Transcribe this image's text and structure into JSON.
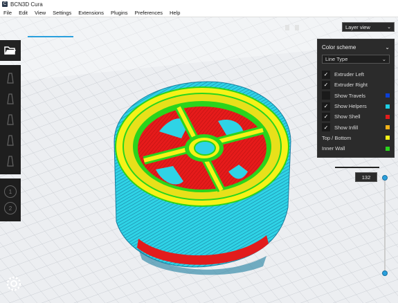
{
  "window": {
    "title": "BCN3D Cura",
    "app_icon_letter": "C"
  },
  "menu": [
    "File",
    "Edit",
    "View",
    "Settings",
    "Extensions",
    "Plugins",
    "Preferences",
    "Help"
  ],
  "view_selector": {
    "value": "Layer view"
  },
  "panel": {
    "title": "Color scheme",
    "dropdown_value": "Line Type",
    "checked_items": [
      {
        "label": "Extruder Left",
        "checked": true
      },
      {
        "label": "Extruder Right",
        "checked": true
      },
      {
        "label": "Show Travels",
        "checked": false,
        "color": "#0b3fd6"
      },
      {
        "label": "Show Helpers",
        "checked": true,
        "color": "#1ecfe4"
      },
      {
        "label": "Show Shell",
        "checked": true,
        "color": "#e21c1c"
      },
      {
        "label": "Show Infill",
        "checked": true,
        "color": "#f3b21a"
      }
    ],
    "legend_items": [
      {
        "label": "Top / Bottom",
        "color": "#f5f218"
      },
      {
        "label": "Inner Wall",
        "color": "#2ad41c"
      }
    ]
  },
  "layer_slider": {
    "value": "132"
  },
  "colors": {
    "accent": "#2aa0dd",
    "panel_bg": "#2b2b2b",
    "shell": "#e21c1c",
    "helpers": "#1ecfe4",
    "top_bottom": "#f5f218",
    "inner_wall": "#2ad41c"
  }
}
